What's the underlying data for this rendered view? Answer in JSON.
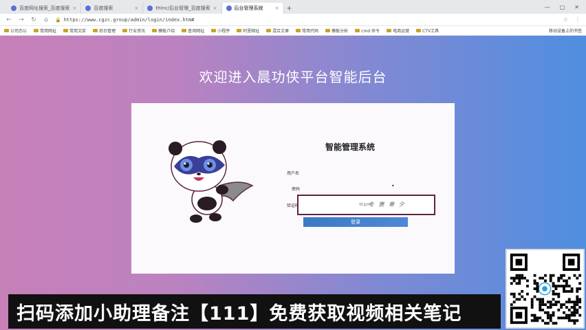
{
  "browser": {
    "tabs": [
      {
        "label": "百度网址搜索_百度搜索"
      },
      {
        "label": "百度搜索"
      },
      {
        "label": "thinc/后台管理_百度搜索"
      },
      {
        "label": "后台管理系统"
      }
    ],
    "new_tab": "+",
    "url": "https://www.cgzc.group/admin/login/index.htm#",
    "bookmarks": [
      "公司办公",
      "常用网址",
      "常用文库",
      "后台管理",
      "行业资讯",
      "模板介绍",
      "查询网址",
      "小程序",
      "阿里网址",
      "混合文章",
      "常用代码",
      "模板分析",
      "cmd 命令",
      "电商运营",
      "CTV工具"
    ],
    "bookmarks_right": "移动设备上的书签"
  },
  "page": {
    "welcome": "欢迎进入晨功侠平台智能后台",
    "system_title": "智能管理系统",
    "form": {
      "username_label": "用户名",
      "password_label": "密码",
      "password_eye": "•",
      "code_label": "验证码",
      "code_input": "验证码",
      "captcha_text": "冬 赛 寒 夕",
      "login_button": "登录"
    }
  },
  "overlay": {
    "banner": "扫码添加小助理备注【111】免费获取视频相关笔记"
  },
  "colors": {
    "gradient_left": "#c780b8",
    "gradient_right": "#4f8ee0",
    "button": "#3a79c6"
  }
}
